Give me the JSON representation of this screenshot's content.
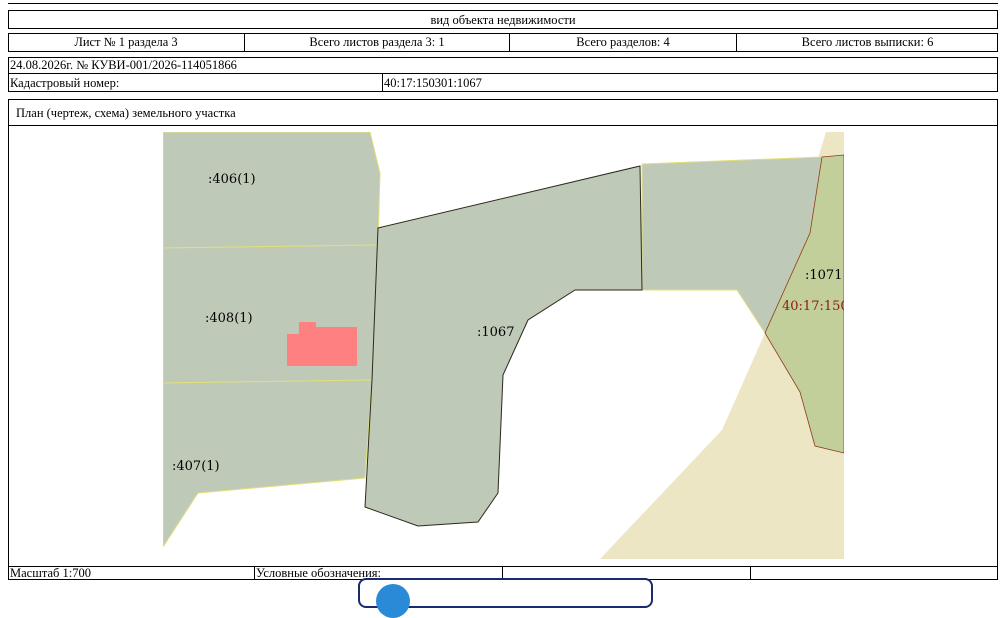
{
  "header": {
    "title": "вид объекта недвижимости"
  },
  "sheet_row": {
    "sheet": "Лист № 1 раздела 3",
    "total_sheets_section": "Всего листов раздела 3: 1",
    "total_sections": "Всего разделов: 4",
    "total_sheets_extract": "Всего листов выписки: 6"
  },
  "doc": {
    "date_number": "24.08.2026г. № КУВИ-001/2026-114051866",
    "cadastral_label": "Кадастровый номер:",
    "cadastral_value": "40:17:150301:1067"
  },
  "plan": {
    "title": "План (чертеж, схема) земельного участка",
    "labels": {
      "parcel_406": ":406(1)",
      "parcel_408": ":408(1)",
      "parcel_407": ":407(1)",
      "parcel_1067": ":1067",
      "parcel_1071": ":1071",
      "parcel_150": "40:17:150"
    },
    "colors": {
      "parcel_fill": "#bfc9b8",
      "neighbor_green": "#c2cf9a",
      "sand": "#ede6c4",
      "building": "#ff8080",
      "boundary_yellow": "#e0e07a",
      "boundary_red": "#8b3a1e"
    }
  },
  "footer": {
    "scale": "Масштаб 1:700",
    "legend_label": "Условные обозначения:"
  }
}
